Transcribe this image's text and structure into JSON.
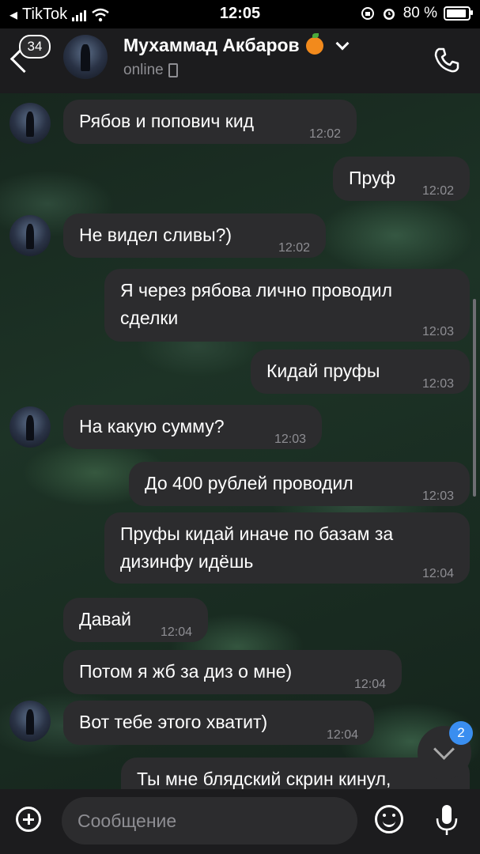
{
  "status_bar": {
    "back_app": "TikTok",
    "time": "12:05",
    "battery": "80 %"
  },
  "header": {
    "unread_count": "34",
    "contact_name": "Мухаммад Акбаров",
    "status": "online"
  },
  "messages": [
    {
      "side": "in",
      "text": "Рябов и попович кид",
      "time": "12:02",
      "avatar": true
    },
    {
      "side": "out",
      "text": "Пруф",
      "time": "12:02"
    },
    {
      "side": "in",
      "text": "Не видел сливы?)",
      "time": "12:02",
      "avatar": true
    },
    {
      "side": "out",
      "text": "Я через рябова лично проводил\nсделки",
      "time": "12:03"
    },
    {
      "side": "out",
      "text": "Кидай пруфы",
      "time": "12:03"
    },
    {
      "side": "in",
      "text": "На какую сумму?",
      "time": "12:03",
      "avatar": true
    },
    {
      "side": "out",
      "text": "До 400 рублей проводил",
      "time": "12:03"
    },
    {
      "side": "out",
      "text": "Пруфы кидай иначе по базам за\nдизинфу идёшь",
      "time": "12:04"
    },
    {
      "side": "in",
      "text": "Давай",
      "time": "12:04",
      "avatar": false
    },
    {
      "side": "in",
      "text": "Потом я жб за диз о мне)",
      "time": "12:04",
      "avatar": false
    },
    {
      "side": "in",
      "text": "Вот тебе этого хватит)",
      "time": "12:04",
      "avatar": true
    },
    {
      "side": "out",
      "text": "Ты мне блядский скрин кинул,",
      "time": ""
    }
  ],
  "scroll_down_badge": "2",
  "composer": {
    "placeholder": "Сообщение"
  }
}
